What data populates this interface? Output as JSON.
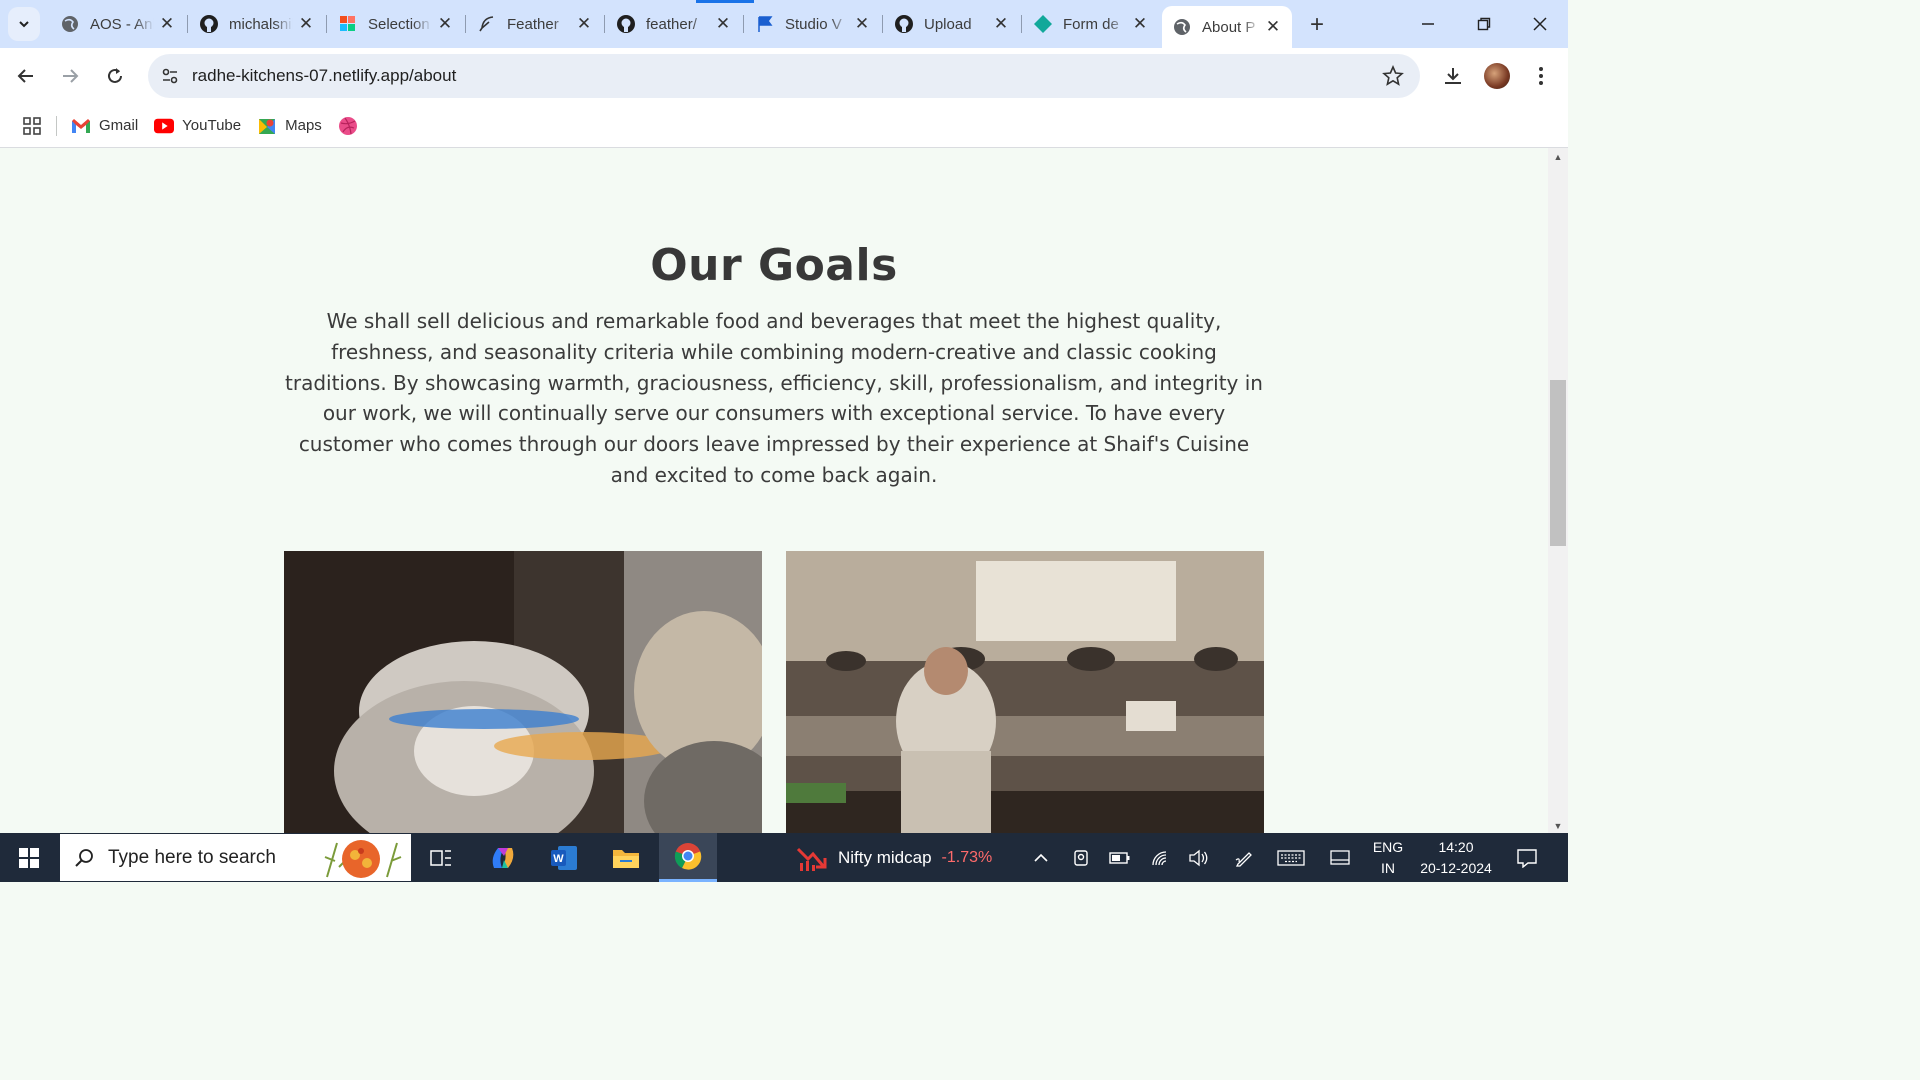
{
  "browser": {
    "tabs": [
      {
        "title": "AOS - Anim",
        "icon": "globe-icon"
      },
      {
        "title": "michalsnik",
        "icon": "github-icon"
      },
      {
        "title": "Selection",
        "icon": "figma-icon"
      },
      {
        "title": "Feather",
        "icon": "feather-icon"
      },
      {
        "title": "feather/",
        "icon": "github-icon"
      },
      {
        "title": "Studio V",
        "icon": "flag-icon"
      },
      {
        "title": "Upload",
        "icon": "github-icon"
      },
      {
        "title": "Form de",
        "icon": "diamond-icon"
      },
      {
        "title": "About P",
        "icon": "globe-icon",
        "active": true
      }
    ],
    "url": "radhe-kitchens-07.netlify.app/about",
    "bookmarks": [
      "Gmail",
      "YouTube",
      "Maps"
    ]
  },
  "page": {
    "goals_title": "Our Goals",
    "goals_text": "We shall sell delicious and remarkable food and beverages that meet the highest quality, freshness, and seasonality criteria while combining modern-creative and classic cooking traditions. By showcasing warmth, graciousness, efficiency, skill, professionalism, and integrity in our work, we will continually serve our consumers with exceptional service. To have every customer who comes through our doors leave impressed by their experience at Shaif's Cuisine and excited to come back again."
  },
  "taskbar": {
    "search_placeholder": "Type here to search",
    "widget_label": "Nifty midcap",
    "widget_value": "-1.73%",
    "lang_top": "ENG",
    "lang_bottom": "IN",
    "time": "14:20",
    "date": "20-12-2024"
  },
  "colors": {
    "tabstrip": "#d3e3fd",
    "page_bg": "#f4faf4",
    "heading": "#383838",
    "taskbar": "#1f2a3a",
    "widget_negative": "#ff6b6b"
  }
}
